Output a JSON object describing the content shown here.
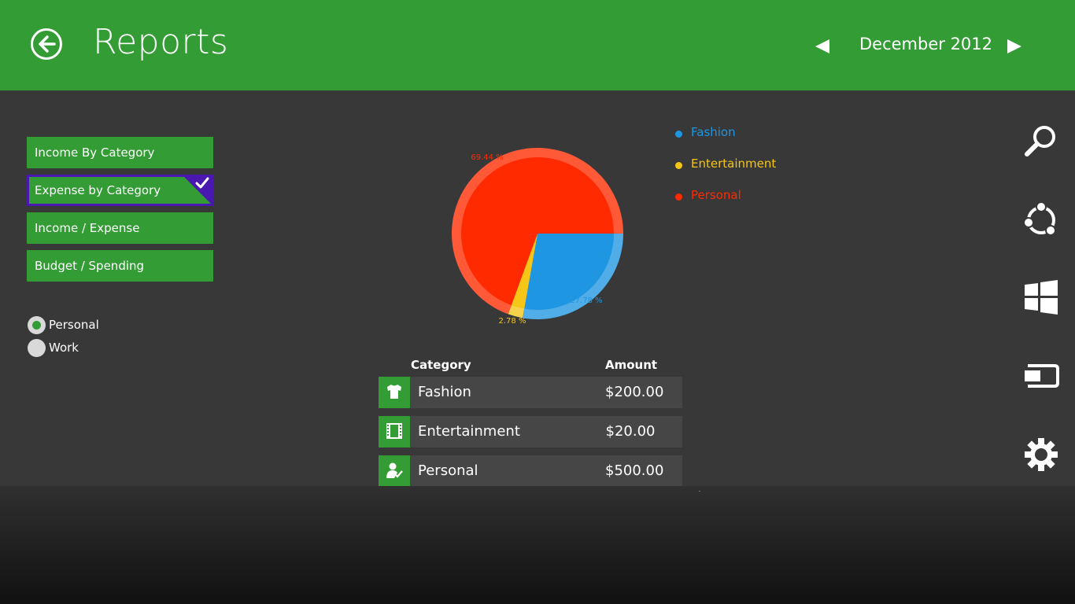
{
  "header": {
    "title": "Reports",
    "month": "December 2012",
    "back_icon": "back-arrow-icon",
    "prev_icon": "triangle-left-icon",
    "next_icon": "triangle-right-icon"
  },
  "report_types": [
    {
      "label": "Income By Category",
      "selected": false
    },
    {
      "label": "Expense by Category",
      "selected": true
    },
    {
      "label": "Income / Expense",
      "selected": false
    },
    {
      "label": "Budget / Spending",
      "selected": false
    }
  ],
  "accounts": [
    {
      "label": "Personal",
      "checked": true
    },
    {
      "label": "Work",
      "checked": false
    }
  ],
  "legend": [
    {
      "label": "Fashion",
      "color": "#1e96e1"
    },
    {
      "label": "Entertainment",
      "color": "#f5c518"
    },
    {
      "label": "Personal",
      "color": "#ff2a00"
    }
  ],
  "chart_data": {
    "type": "pie",
    "slices": [
      {
        "label": "Fashion",
        "value": 27.78,
        "label_text": "27.78 %",
        "color": "#1e96e1"
      },
      {
        "label": "Entertainment",
        "value": 2.78,
        "label_text": "2.78 %",
        "color": "#f5c518"
      },
      {
        "label": "Personal",
        "value": 69.44,
        "label_text": "69.44 %",
        "color": "#ff2a00"
      }
    ]
  },
  "table": {
    "headers": {
      "category": "Category",
      "amount": "Amount"
    },
    "rows": [
      {
        "category": "Fashion",
        "amount": "$200.00",
        "icon": "shirt-icon"
      },
      {
        "category": "Entertainment",
        "amount": "$20.00",
        "icon": "film-icon"
      },
      {
        "category": "Personal",
        "amount": "$500.00",
        "icon": "person-check-icon"
      }
    ]
  },
  "charms": [
    "search-icon",
    "share-icon",
    "windows-start-icon",
    "devices-icon",
    "settings-gear-icon"
  ],
  "colors": {
    "accent": "#339c35",
    "selected_border": "#4a18b0",
    "background": "#383838"
  }
}
